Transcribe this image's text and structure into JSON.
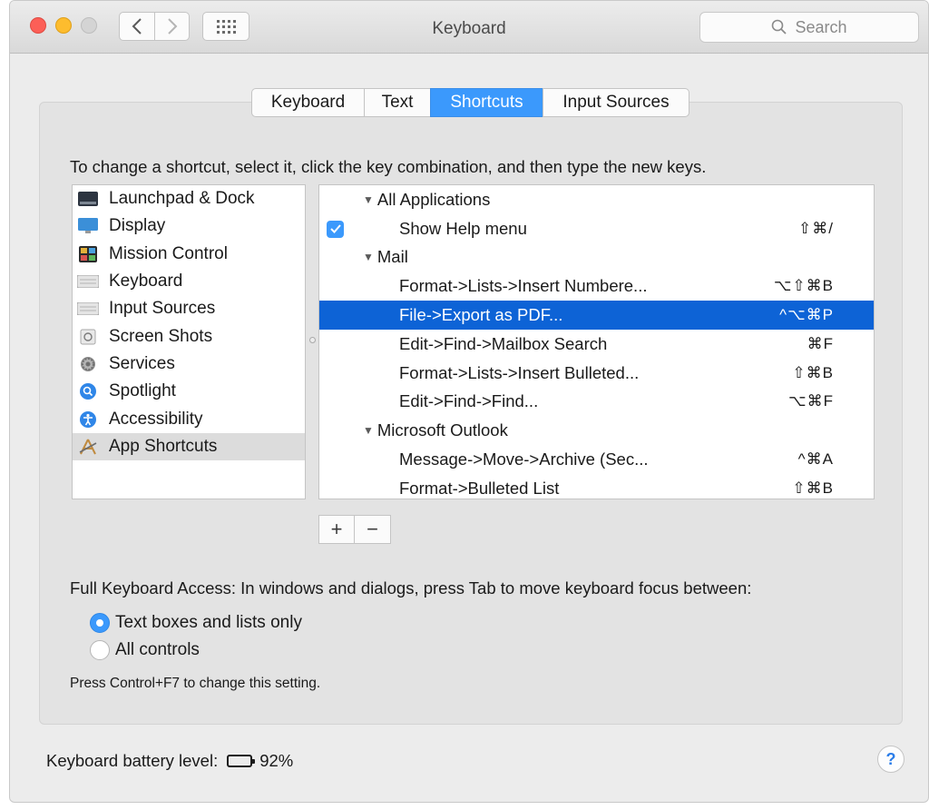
{
  "window": {
    "title": "Keyboard"
  },
  "search": {
    "placeholder": "Search"
  },
  "tabs": [
    {
      "label": "Keyboard",
      "active": false
    },
    {
      "label": "Text",
      "active": false
    },
    {
      "label": "Shortcuts",
      "active": true
    },
    {
      "label": "Input Sources",
      "active": false
    }
  ],
  "instruction": "To change a shortcut, select it, click the key combination, and then type the new keys.",
  "categories": [
    {
      "label": "Launchpad & Dock",
      "icon": "launchpad-dock-icon"
    },
    {
      "label": "Display",
      "icon": "display-icon"
    },
    {
      "label": "Mission Control",
      "icon": "mission-control-icon"
    },
    {
      "label": "Keyboard",
      "icon": "keyboard-icon"
    },
    {
      "label": "Input Sources",
      "icon": "input-sources-icon"
    },
    {
      "label": "Screen Shots",
      "icon": "screen-shots-icon"
    },
    {
      "label": "Services",
      "icon": "services-gear-icon"
    },
    {
      "label": "Spotlight",
      "icon": "spotlight-icon"
    },
    {
      "label": "Accessibility",
      "icon": "accessibility-icon"
    },
    {
      "label": "App Shortcuts",
      "icon": "app-shortcuts-icon",
      "selected": true
    }
  ],
  "shortcuts": [
    {
      "type": "group",
      "label": "All Applications"
    },
    {
      "type": "item",
      "label": "Show Help menu",
      "keys": "⇧⌘/",
      "checked": true
    },
    {
      "type": "group",
      "label": "Mail"
    },
    {
      "type": "item",
      "label": "Format->Lists->Insert Numbere...",
      "keys": "⌥⇧⌘B"
    },
    {
      "type": "item",
      "label": "File->Export as PDF...",
      "keys": "^⌥⌘P",
      "selected": true
    },
    {
      "type": "item",
      "label": "Edit->Find->Mailbox Search",
      "keys": "⌘F"
    },
    {
      "type": "item",
      "label": "Format->Lists->Insert Bulleted...",
      "keys": "⇧⌘B"
    },
    {
      "type": "item",
      "label": "Edit->Find->Find...",
      "keys": "⌥⌘F"
    },
    {
      "type": "group",
      "label": "Microsoft Outlook"
    },
    {
      "type": "item",
      "label": "Message->Move->Archive (Sec...",
      "keys": "^⌘A"
    },
    {
      "type": "item",
      "label": "Format->Bulleted List",
      "keys": "⇧⌘B"
    }
  ],
  "buttons": {
    "add": "+",
    "remove": "−"
  },
  "full_keyboard_access": {
    "label": "Full Keyboard Access: In windows and dialogs, press Tab to move keyboard focus between:",
    "options": [
      {
        "label": "Text boxes and lists only",
        "selected": true
      },
      {
        "label": "All controls",
        "selected": false
      }
    ],
    "note": "Press Control+F7 to change this setting."
  },
  "battery": {
    "label": "Keyboard battery level:",
    "level_text": "92%",
    "level": 0.92
  },
  "help": {
    "label": "?"
  },
  "colors": {
    "accent": "#3b99fc",
    "selection": "#0d63d6"
  }
}
